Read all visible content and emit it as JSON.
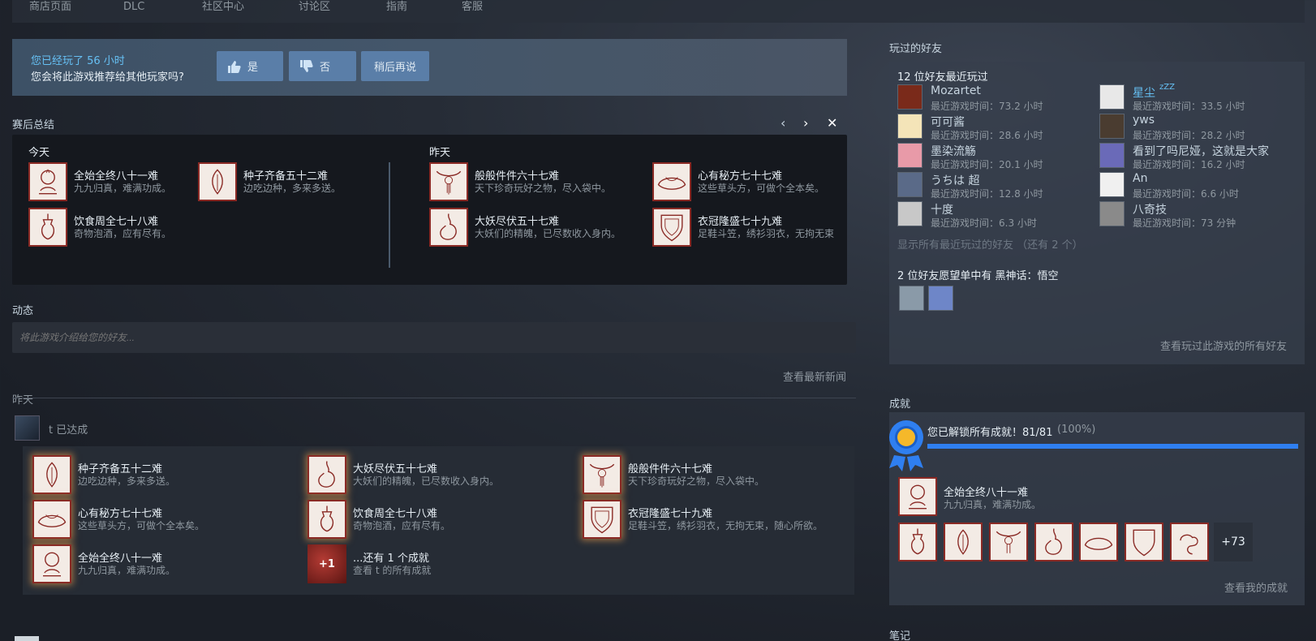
{
  "nav": {
    "items": [
      "商店页面",
      "DLC",
      "社区中心",
      "讨论区",
      "指南",
      "客服"
    ]
  },
  "review": {
    "played": "您已经玩了 56 小时",
    "question": "您会将此游戏推荐给其他玩家吗?",
    "yes": "是",
    "no": "否",
    "later": "稍后再说"
  },
  "summary": {
    "title": "赛后总结",
    "today_label": "今天",
    "yesterday_label": "昨天",
    "today": [
      {
        "name": "全始全终八十一难",
        "desc": "九九归真，难满功成。"
      },
      {
        "name": "种子齐备五十二难",
        "desc": "边吃边种，多来多送。"
      },
      {
        "name": "饮食周全七十八难",
        "desc": "奇物泡酒，应有尽有。"
      }
    ],
    "yesterday": [
      {
        "name": "般般件件六十七难",
        "desc": "天下珍奇玩好之物，尽入袋中。"
      },
      {
        "name": "心有秘方七十七难",
        "desc": "这些草头方，可做个全本矣。"
      },
      {
        "name": "大妖尽伏五十七难",
        "desc": "大妖们的精魄，已尽数收入身内。"
      },
      {
        "name": "衣冠隆盛七十九难",
        "desc": "足鞋斗笠，绣衫羽衣，无拘无束"
      }
    ]
  },
  "activity": {
    "title": "动态",
    "placeholder": "将此游戏介绍给您的好友...",
    "news_link": "查看最新新闻",
    "yesterday": "昨天",
    "user_line": "t 已达成",
    "feed": [
      {
        "name": "种子齐备五十二难",
        "desc": "边吃边种，多来多送。"
      },
      {
        "name": "大妖尽伏五十七难",
        "desc": "大妖们的精魄，已尽数收入身内。"
      },
      {
        "name": "般般件件六十七难",
        "desc": "天下珍奇玩好之物，尽入袋中。"
      },
      {
        "name": "心有秘方七十七难",
        "desc": "这些草头方，可做个全本矣。"
      },
      {
        "name": "饮食周全七十八难",
        "desc": "奇物泡酒，应有尽有。"
      },
      {
        "name": "衣冠隆盛七十九难",
        "desc": "足鞋斗笠，绣衫羽衣，无拘无束，随心所欲。"
      },
      {
        "name": "全始全终八十一难",
        "desc": "九九归真，难满功成。"
      }
    ],
    "more": {
      "badge": "+1",
      "name": "...还有 1 个成就",
      "desc": "查看 t 的所有成就"
    }
  },
  "friends": {
    "title": "玩过的好友",
    "recent_header": "12 位好友最近玩过",
    "list": [
      {
        "name": "Mozartet",
        "time": "最近游戏时间：73.2 小时",
        "color": "#7a2a1a"
      },
      {
        "name": "星尘",
        "time": "最近游戏时间：33.5 小时",
        "color": "#e8e8e8"
      },
      {
        "name": "可可酱",
        "time": "最近游戏时间：28.6 小时",
        "color": "#f4e4b8"
      },
      {
        "name": "yws",
        "time": "最近游戏时间：28.2 小时",
        "color": "#4a3c30"
      },
      {
        "name": "墨染流觞",
        "time": "最近游戏时间：20.1 小时",
        "color": "#e89aa8"
      },
      {
        "name": "看到了吗尼娅，这就是大家",
        "time": "最近游戏时间：16.2 小时",
        "color": "#6a6ab8"
      },
      {
        "name": "うちは 超",
        "time": "最近游戏时间：12.8 小时",
        "color": "#5a6a88"
      },
      {
        "name": "An",
        "time": "最近游戏时间：6.6 小时",
        "color": "#f0f0f0"
      },
      {
        "name": "十度",
        "time": "最近游戏时间：6.3 小时",
        "color": "#c8c8c8"
      },
      {
        "name": "八奇技",
        "time": "最近游戏时间：73 分钟",
        "color": "#8a8a8a"
      }
    ],
    "zzz": "zZZ",
    "show_all": "显示所有最近玩过的好友 （还有 2 个）",
    "wishlist": "2 位好友愿望单中有 黑神话：悟空",
    "view_all": "查看玩过此游戏的所有好友"
  },
  "achievements": {
    "title": "成就",
    "unlocked_text": "您已解锁所有成就！81/81",
    "percent_text": "(100%)",
    "progress": 1.0,
    "featured": {
      "name": "全始全终八十一难",
      "desc": "九九归真，难满功成。"
    },
    "more_count": "+73",
    "view_mine": "查看我的成就"
  },
  "notes_title": "笔记"
}
